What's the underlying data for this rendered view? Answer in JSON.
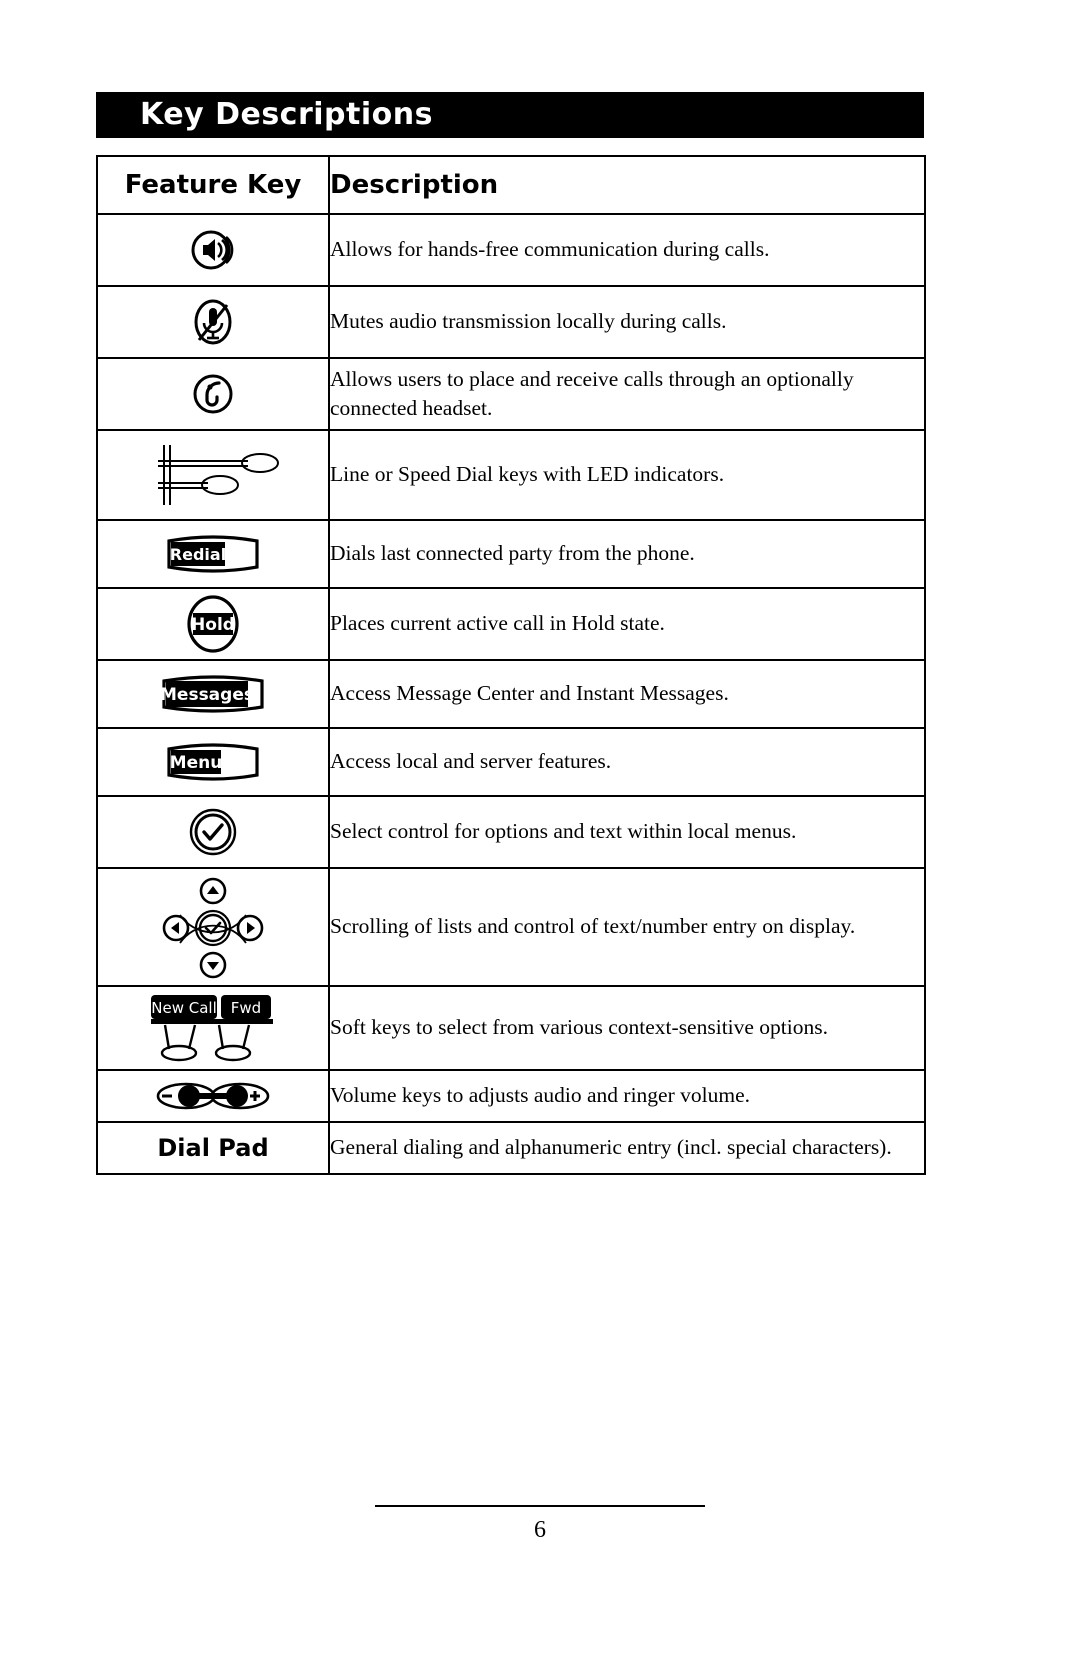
{
  "header": {
    "title": "Key Descriptions"
  },
  "table": {
    "columns": [
      "Feature Key",
      "Description"
    ],
    "rows": [
      {
        "icon": "speaker-icon",
        "key_label": "",
        "description": "Allows for hands-free communication during calls."
      },
      {
        "icon": "mute-microphone-icon",
        "key_label": "",
        "description": "Mutes audio transmission locally during calls."
      },
      {
        "icon": "headset-icon",
        "key_label": "",
        "description": "Allows users to place and receive calls through an optionally connected headset."
      },
      {
        "icon": "line-keys-icon",
        "key_label": "",
        "description": "Line or Speed Dial keys with LED indicators."
      },
      {
        "icon": "redial-key-icon",
        "key_label": "Redial",
        "description": "Dials last connected party from the phone."
      },
      {
        "icon": "hold-key-icon",
        "key_label": "Hold",
        "description": "Places current active call in Hold state."
      },
      {
        "icon": "messages-key-icon",
        "key_label": "Messages",
        "description": "Access Message Center and Instant Messages."
      },
      {
        "icon": "menu-key-icon",
        "key_label": "Menu",
        "description": "Access local and server features."
      },
      {
        "icon": "select-key-icon",
        "key_label": "",
        "description": "Select control for options and text within local menus."
      },
      {
        "icon": "navigation-cluster-icon",
        "key_label": "",
        "description": "Scrolling of lists and control of text/number entry on display."
      },
      {
        "icon": "soft-keys-icon",
        "key_label": "",
        "description": "Soft keys to select from various context-sensitive options."
      },
      {
        "icon": "volume-keys-icon",
        "key_label": "",
        "description": "Volume keys to adjusts audio and ringer volume."
      },
      {
        "icon": "dial-pad-label",
        "key_label": "Dial Pad",
        "description": "General dialing and alphanumeric entry (incl. special characters)."
      }
    ],
    "soft_key_labels": [
      "New Call",
      "Fwd"
    ]
  },
  "footer": {
    "page_number": "6"
  },
  "colors": {
    "ink": "#000000",
    "paper": "#ffffff"
  }
}
